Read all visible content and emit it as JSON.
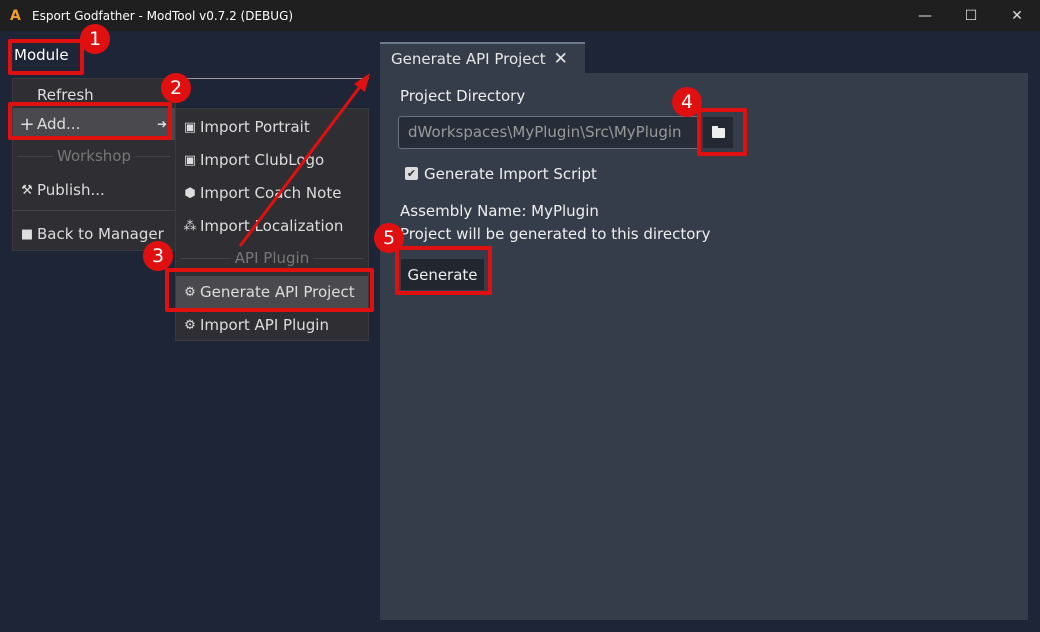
{
  "window": {
    "title": "Esport Godfather - ModTool v0.7.2 (DEBUG)",
    "minimize": "—",
    "maximize": "☐",
    "close": "✕"
  },
  "menubar": {
    "module": "Module"
  },
  "module_menu": {
    "items": [
      {
        "label": "Refresh",
        "icon": ""
      },
      {
        "label": "Add...",
        "icon": "plus-icon",
        "glyph": "+",
        "arrow": "➜"
      },
      {
        "separator": "Workshop"
      },
      {
        "label": "Publish...",
        "icon": "hammer-icon",
        "glyph": "⚒"
      },
      {
        "label": "Back to Manager",
        "icon": "folder-icon",
        "glyph": "■"
      }
    ]
  },
  "add_submenu": {
    "items": [
      {
        "label": "Import Portrait",
        "glyph": "▣"
      },
      {
        "label": "Import ClubLogo",
        "glyph": "▣"
      },
      {
        "label": "Import Coach Note",
        "glyph": "⬢"
      },
      {
        "label": "Import Localization",
        "glyph": "⁂"
      },
      {
        "separator": "API Plugin"
      },
      {
        "label": "Generate API Project",
        "glyph": "⚙"
      },
      {
        "label": "Import API Plugin",
        "glyph": "⚙"
      }
    ]
  },
  "tab": {
    "label": "Generate API Project",
    "close": "✕"
  },
  "form": {
    "project_directory_label": "Project Directory",
    "project_directory_value": "dWorkspaces\\MyPlugin\\Src\\MyPlugin",
    "checkbox_label": "Generate Import Script",
    "checkbox_checked": true,
    "checkmark": "✔",
    "assembly_name": "Assembly Name: MyPlugin",
    "info": "Project will be generated to this directory",
    "generate_button": "Generate"
  },
  "annotations": {
    "color": "#e01010",
    "steps": [
      "1",
      "2",
      "3",
      "4",
      "5"
    ]
  }
}
